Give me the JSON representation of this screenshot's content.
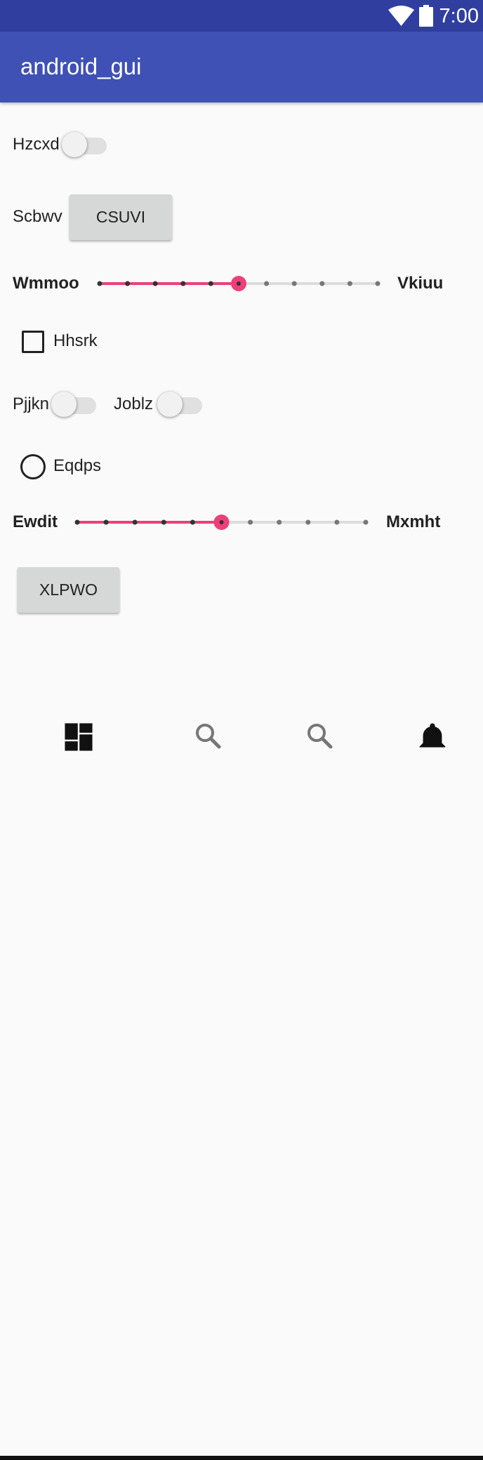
{
  "status_bar": {
    "time": "7:00",
    "icons": [
      "wifi-icon",
      "battery-icon"
    ]
  },
  "app_bar": {
    "title": "android_gui"
  },
  "form": {
    "switch1": {
      "label": "Hzcxd",
      "on": false
    },
    "button1": {
      "label_left": "Scbwv",
      "button_label": "CSUVI"
    },
    "slider1": {
      "label_left": "Wmmoo",
      "label_right": "Vkiuu",
      "steps": 10,
      "value": 5
    },
    "checkbox1": {
      "label": "Hhsrk",
      "checked": false
    },
    "switch2": {
      "label": "Pjjkn",
      "on": false
    },
    "switch3": {
      "label": "Joblz",
      "on": false
    },
    "radio1": {
      "label": "Eqdps",
      "selected": false
    },
    "slider2": {
      "label_left": "Ewdit",
      "label_right": "Mxmht",
      "steps": 10,
      "value": 5
    },
    "button2": {
      "button_label": "XLPWO"
    }
  },
  "bottom_nav": {
    "items": [
      "dashboard-icon",
      "search-icon",
      "search-icon",
      "notifications-icon"
    ]
  },
  "colors": {
    "status_bar": "#303f9f",
    "app_bar": "#3f51b5",
    "accent": "#ec407a",
    "background": "#fafafa"
  }
}
